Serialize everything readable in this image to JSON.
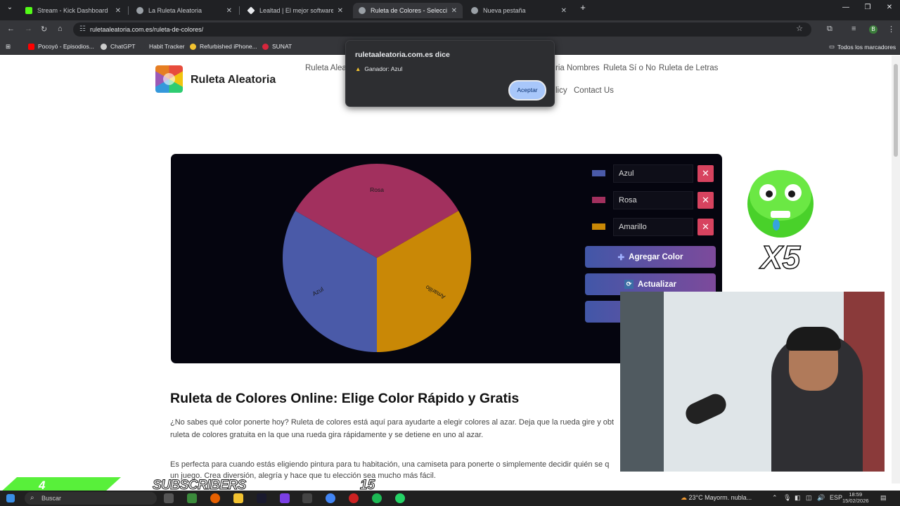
{
  "browser": {
    "tabs": [
      {
        "title": "Stream - Kick Dashboard",
        "icon": "kick-icon",
        "color": "#53fc18",
        "active": false
      },
      {
        "title": "La Ruleta Aleatoria",
        "icon": "globe-icon",
        "color": "#9aa0a6",
        "active": false
      },
      {
        "title": "Lealtad | El mejor software par",
        "icon": "diamond-icon",
        "color": "#e8eaed",
        "active": false
      },
      {
        "title": "Ruleta de Colores - Selecciona",
        "icon": "globe-icon",
        "color": "#9aa0a6",
        "active": true
      },
      {
        "title": "Nueva pestaña",
        "icon": "chrome-icon",
        "color": "#9aa0a6",
        "active": false
      }
    ],
    "url": "ruletaaleatoria.com.es/ruleta-de-colores/",
    "bookmarks": [
      {
        "label": "Pocoyó - Episodios...",
        "icon": "youtube-icon",
        "color": "#ff0000"
      },
      {
        "label": "ChatGPT",
        "icon": "chatgpt-icon",
        "color": "#cccccc"
      },
      {
        "label": "Habit Tracker",
        "icon": "habit-icon",
        "color": "#35363a"
      },
      {
        "label": "Refurbished iPhone...",
        "icon": "refurb-icon",
        "color": "#f2c230"
      },
      {
        "label": "SUNAT",
        "icon": "sunat-icon",
        "color": "#d6263c"
      }
    ],
    "all_bookmarks": "Todos los marcadores"
  },
  "site": {
    "brand": "Ruleta Aleatoria",
    "nav_top": [
      "Ruleta Alea",
      "ria Nombres",
      "Ruleta Sí o No",
      "Ruleta de Letras"
    ],
    "nav_bottom": [
      "licy",
      "Contact Us"
    ]
  },
  "wheel": {
    "segments": [
      {
        "label": "Rosa",
        "color": "#a2305e",
        "angle_start": -60,
        "angle_end": 60
      },
      {
        "label": "Amarillo",
        "color": "#c98806",
        "angle_start": 60,
        "angle_end": 180
      },
      {
        "label": "Azul",
        "color": "#4a5aa8",
        "angle_start": 180,
        "angle_end": 300
      }
    ]
  },
  "colors": [
    {
      "name": "Azul",
      "swatch": "#4a5aa8"
    },
    {
      "name": "Rosa",
      "swatch": "#a2305e"
    },
    {
      "name": "Amarillo",
      "swatch": "#c98806"
    }
  ],
  "buttons": {
    "add": "Agregar Color",
    "update": "Actualizar"
  },
  "article": {
    "title": "Ruleta de Colores Online: Elige Color Rápido y Gratis",
    "para1_line1": "¿No sabes qué color ponerte hoy? Ruleta de colores está aquí para ayudarte a elegir colores al azar. Deja que la rueda gire y obt",
    "para1_line2": "ruleta de colores gratuita en la que una rueda gira rápidamente y se detiene en uno al azar.",
    "para2_line1": "Es perfecta para cuando estás eligiendo pintura para tu habitación, una camiseta para ponerte o simplemente decidir quién se q",
    "para2_line2": "un juego. Crea diversión, alegría y hace que tu elección sea mucho más fácil."
  },
  "dialog": {
    "title": "ruletaaleatoria.com.es dice",
    "message": "Ganador: Azul",
    "ok": "Aceptar"
  },
  "stream": {
    "multiplier": "X5",
    "sub_count": "4",
    "sub_label": "SUBSCRIBERS",
    "sub_goal": "15"
  },
  "taskbar": {
    "search": "Buscar",
    "weather": "23°C  Mayorm. nubla...",
    "lang": "ESP",
    "time": "18:59",
    "date": "15/02/2026"
  }
}
